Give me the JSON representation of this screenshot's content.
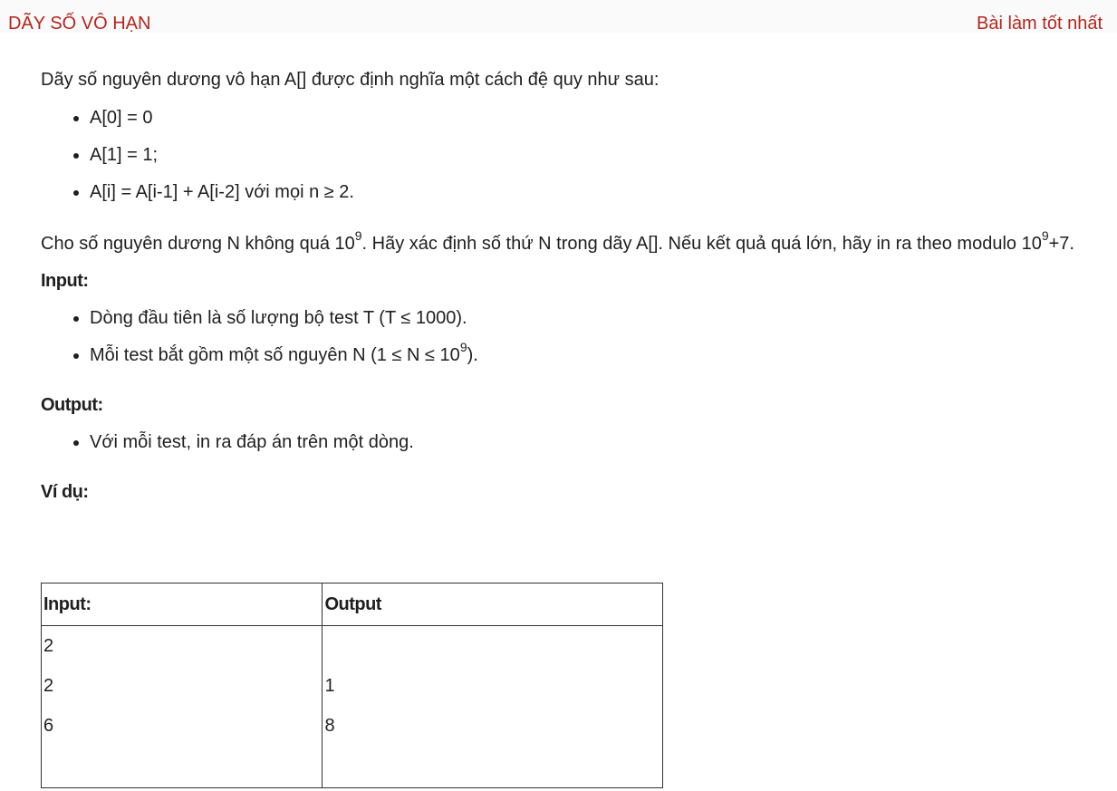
{
  "header": {
    "title": "DÃY SỐ VÔ HẠN",
    "best_link": "Bài làm tốt nhất"
  },
  "statement": {
    "intro": "Dãy số nguyên dương vô hạn A[] được định nghĩa một cách đệ quy như sau:",
    "rules": [
      "A[0] = 0",
      "A[1] = 1;",
      "A[i] = A[i-1] + A[i-2] với mọi n ≥ 2."
    ],
    "para_part1": "Cho số nguyên dương N không quá 10",
    "para_sup1": "9",
    "para_part2": ". Hãy xác định số thứ N trong dãy A[]. Nếu kết quả quá lớn, hãy in ra theo modulo 10",
    "para_sup2": "9",
    "para_part3": "+7."
  },
  "input_section": {
    "heading": "Input:",
    "item1": "Dòng đầu tiên là số lượng bộ test T (T ≤ 1000).",
    "item2_part1": "Mỗi test bắt gồm một số nguyên N (1 ≤ N ≤ 10",
    "item2_sup": "9",
    "item2_part2": ")."
  },
  "output_section": {
    "heading": "Output:",
    "item1": "Với mỗi test, in ra đáp án trên một dòng."
  },
  "example": {
    "heading": "Ví dụ:",
    "col_input": "Input:",
    "col_output": "Output",
    "input_lines": [
      "2",
      "2",
      "6"
    ],
    "output_lines": [
      "",
      "1",
      "8"
    ]
  }
}
